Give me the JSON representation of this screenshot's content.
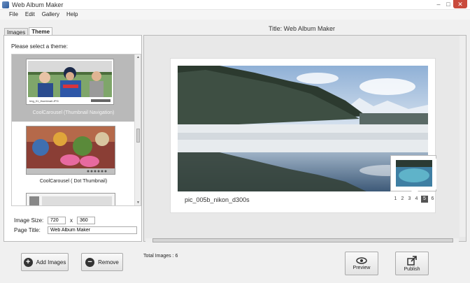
{
  "window": {
    "title": "Web Album Maker",
    "controls": [
      "–",
      "□",
      "✕"
    ]
  },
  "menu": [
    "File",
    "Edit",
    "Gallery",
    "Help"
  ],
  "tabs": [
    {
      "label": "Images",
      "active": false
    },
    {
      "label": "Theme",
      "active": true
    }
  ],
  "theme_panel": {
    "label": "Please select a theme:",
    "themes": [
      {
        "name": "CoolCarousel (Thumbnail Navigation)",
        "thumb_caption": "Img_01_thumbnail.JPG",
        "selected": true
      },
      {
        "name": "CoolCarousel ( Dot Thumbnail)",
        "selected": false
      },
      {
        "name": "",
        "selected": false
      }
    ],
    "image_size_label": "Image Size:",
    "width": "720",
    "times": "x",
    "height": "360",
    "page_title_label": "Page Title:",
    "page_title_value": "Web Album Maker"
  },
  "preview": {
    "title": "Title: Web Album Maker",
    "caption": "pic_005b_nikon_d300s",
    "pages": [
      "1",
      "2",
      "3",
      "4",
      "5",
      "6"
    ],
    "active_page": "5"
  },
  "footer": {
    "add_images": "Add Images",
    "remove": "Remove",
    "total": "Total Images : 6",
    "preview_btn": "Preview",
    "publish_btn": "Publish"
  }
}
